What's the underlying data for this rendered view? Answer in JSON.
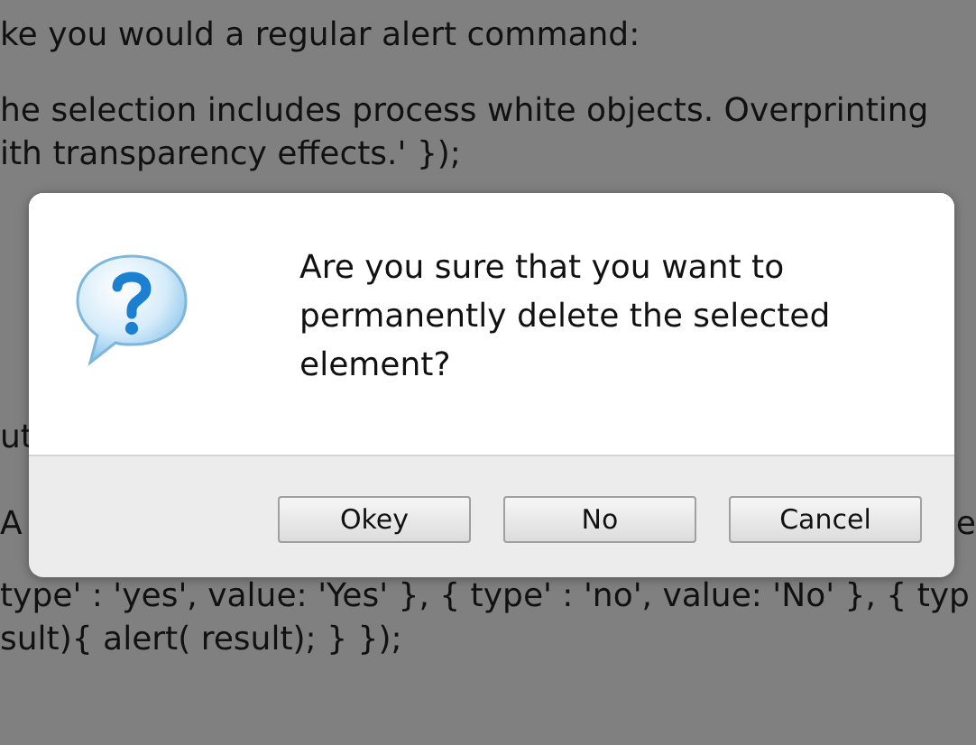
{
  "page": {
    "lines": [
      {
        "left": "ke you would a regular alert command:"
      },
      {
        "left": "he selection includes process white objects. Overprinting"
      },
      {
        "left": "ith transparency effects.' });"
      },
      {
        "left": "ut"
      },
      {
        "left": "A",
        "right": "e"
      },
      {
        "left": "type' : 'yes', value: 'Yes' }, { type' : 'no', value: 'No' }, { typ"
      },
      {
        "left": "sult){ alert( result); } });"
      }
    ]
  },
  "dialog": {
    "message": "Are you sure that you want to permanently delete the selected element?",
    "buttons": [
      "Okey",
      "No",
      "Cancel"
    ]
  }
}
